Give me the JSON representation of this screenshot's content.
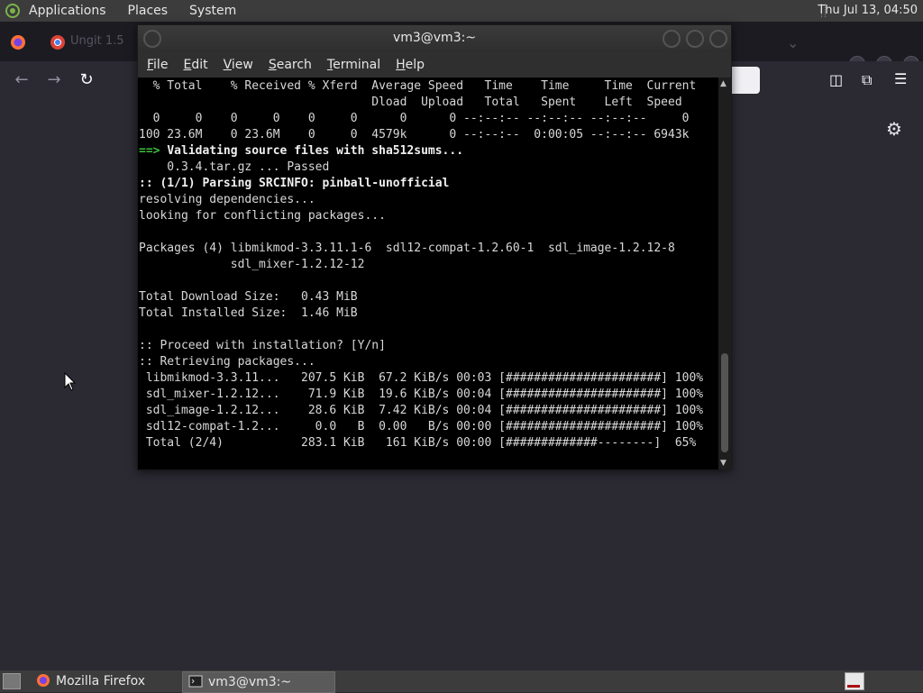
{
  "top_panel": {
    "menus": [
      "Applications",
      "Places",
      "System"
    ],
    "clock": "Thu Jul 13, 04:50"
  },
  "firefox": {
    "tab_title": "Ungit 1.5",
    "window_title": "Mozilla Firefox"
  },
  "terminal": {
    "title": "vm3@vm3:~",
    "menu": [
      "File",
      "Edit",
      "View",
      "Search",
      "Terminal",
      "Help"
    ],
    "lines": [
      "  % Total    % Received % Xferd  Average Speed   Time    Time     Time  Current",
      "                                 Dload  Upload   Total   Spent    Left  Speed",
      "  0     0    0     0    0     0      0      0 --:--:-- --:--:-- --:--:--     0",
      "100 23.6M    0 23.6M    0     0  4579k      0 --:--:--  0:00:05 --:--:-- 6943k",
      "==> Validating source files with sha512sums...",
      "    0.3.4.tar.gz ... Passed",
      ":: (1/1) Parsing SRCINFO: pinball-unofficial",
      "resolving dependencies...",
      "looking for conflicting packages...",
      "",
      "Packages (4) libmikmod-3.3.11.1-6  sdl12-compat-1.2.60-1  sdl_image-1.2.12-8",
      "             sdl_mixer-1.2.12-12",
      "",
      "Total Download Size:   0.43 MiB",
      "Total Installed Size:  1.46 MiB",
      "",
      ":: Proceed with installation? [Y/n]",
      ":: Retrieving packages...",
      " libmikmod-3.3.11...   207.5 KiB  67.2 KiB/s 00:03 [######################] 100%",
      " sdl_mixer-1.2.12...    71.9 KiB  19.6 KiB/s 00:04 [######################] 100%",
      " sdl_image-1.2.12...    28.6 KiB  7.42 KiB/s 00:04 [######################] 100%",
      " sdl12-compat-1.2...     0.0   B  0.00   B/s 00:00 [######################] 100%",
      " Total (2/4)           283.1 KiB   161 KiB/s 00:00 [#############--------]  65%"
    ],
    "validating_prefix": "==> ",
    "validating_text": "Validating source files with sha512sums...",
    "parsing_prefix": ":: ",
    "parsing_text": "(1/1) Parsing SRCINFO: pinball-unofficial"
  },
  "taskbar": {
    "items": [
      "Mozilla Firefox",
      "vm3@vm3:~"
    ]
  }
}
